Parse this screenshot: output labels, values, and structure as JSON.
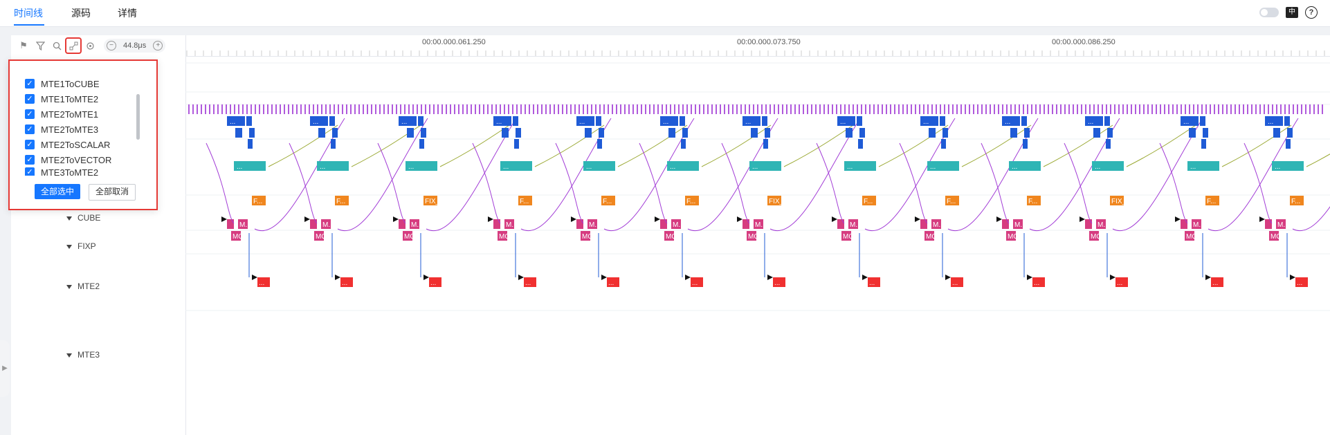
{
  "tabs": [
    {
      "label": "时间线",
      "active": true
    },
    {
      "label": "源码",
      "active": false
    },
    {
      "label": "详情",
      "active": false
    }
  ],
  "topright": {
    "lang_icon": "中英",
    "help": "?"
  },
  "toolbar": {
    "icons": [
      "flag-icon",
      "filter-icon",
      "search-icon",
      "link-icon",
      "target-icon"
    ],
    "zoom_value": "44.8μs",
    "zoom_minus": "−",
    "zoom_plus": "+"
  },
  "ruler": {
    "labels": [
      {
        "text": "00:00.000.061.250",
        "at": 0.25
      },
      {
        "text": "00:00.000.073.750",
        "at": 0.54
      },
      {
        "text": "00:00.000.086.250",
        "at": 0.82
      }
    ]
  },
  "dropdown": {
    "items": [
      "MTE1ToCUBE",
      "MTE1ToMTE2",
      "MTE2ToMTE1",
      "MTE2ToMTE3",
      "MTE2ToSCALAR",
      "MTE2ToVECTOR",
      "MTE3ToMTE2"
    ],
    "select_all": "全部选中",
    "deselect_all": "全部取消"
  },
  "lanes": [
    {
      "name": "CUBE",
      "color": "#2fb5b5"
    },
    {
      "name": "FIXP",
      "color": "#f0861e"
    },
    {
      "name": "MTE2",
      "color": "#d63c80"
    },
    {
      "name": "MTE3",
      "color": "#f03030"
    }
  ],
  "colors": {
    "accent": "#1677ff",
    "scalar": "#a23cd6",
    "vector": "#1f5bd6"
  },
  "block_labels": {
    "dots": "...",
    "cube": "...",
    "fixp": "F...",
    "fixl": "FIX_L...",
    "mte2a": "M...",
    "mte2b": "MO...",
    "mte3": "...",
    "mte3b": "M..."
  }
}
